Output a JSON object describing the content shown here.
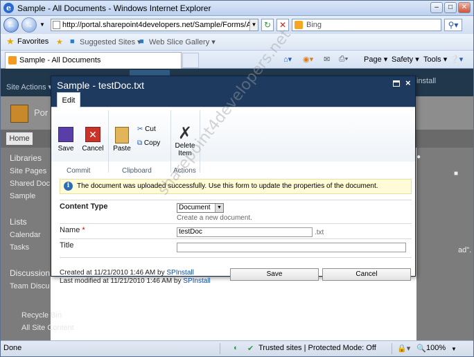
{
  "browser": {
    "window_title": "Sample - All Documents - Windows Internet Explorer",
    "address": "http://portal.sharepoint4developers.net/Sample/Forms/AllItems.a",
    "search_placeholder": "Bing",
    "favorites_label": "Favorites",
    "fav_items": [
      "Suggested Sites ▾",
      "Web Slice Gallery ▾"
    ],
    "tab_title": "Sample - All Documents",
    "commands": [
      "Page ▾",
      "Safety ▾",
      "Tools ▾"
    ],
    "status": {
      "done": "Done",
      "zone": "Trusted sites | Protected Mode: Off",
      "zoom": "100%"
    }
  },
  "sharepoint": {
    "site_actions": "Site Actions ▾",
    "user": "install",
    "portal_name": "Por",
    "home_tab": "Home",
    "quicklaunch": {
      "libraries": "Libraries",
      "site_pages": "Site Pages",
      "shared_docs": "Shared Doc",
      "sample": "Sample",
      "lists": "Lists",
      "calendar": "Calendar",
      "tasks": "Tasks",
      "discussions": "Discussion",
      "team_disc": "Team Discu",
      "recycle_bin": "Recycle Bin",
      "all_site_content": "All Site Content"
    },
    "right_text": "ad\"."
  },
  "dialog": {
    "title": "Sample - testDoc.txt",
    "edit_tab": "Edit",
    "ribbon": {
      "save": "Save",
      "cancel": "Cancel",
      "paste": "Paste",
      "cut": "Cut",
      "copy": "Copy",
      "delete_item": "Delete Item",
      "groups": [
        "Commit",
        "Clipboard",
        "Actions"
      ]
    },
    "message": "The document was uploaded successfully. Use this form to update the properties of the document.",
    "fields": {
      "content_type_label": "Content Type",
      "content_type_value": "Document",
      "content_type_hint": "Create a new document.",
      "name_label": "Name",
      "name_required": "*",
      "name_value": "testDoc",
      "name_ext": ".txt",
      "title_label": "Title",
      "title_value": ""
    },
    "meta": {
      "created_prefix": "Created at 11/21/2010 1:46 AM  by",
      "created_by": "SPInstall",
      "modified_prefix": "Last modified at 11/21/2010 1:46 AM  by",
      "modified_by": "SPInstall"
    },
    "buttons": {
      "save": "Save",
      "cancel": "Cancel"
    }
  },
  "watermark": "sharepoint4developers.net"
}
